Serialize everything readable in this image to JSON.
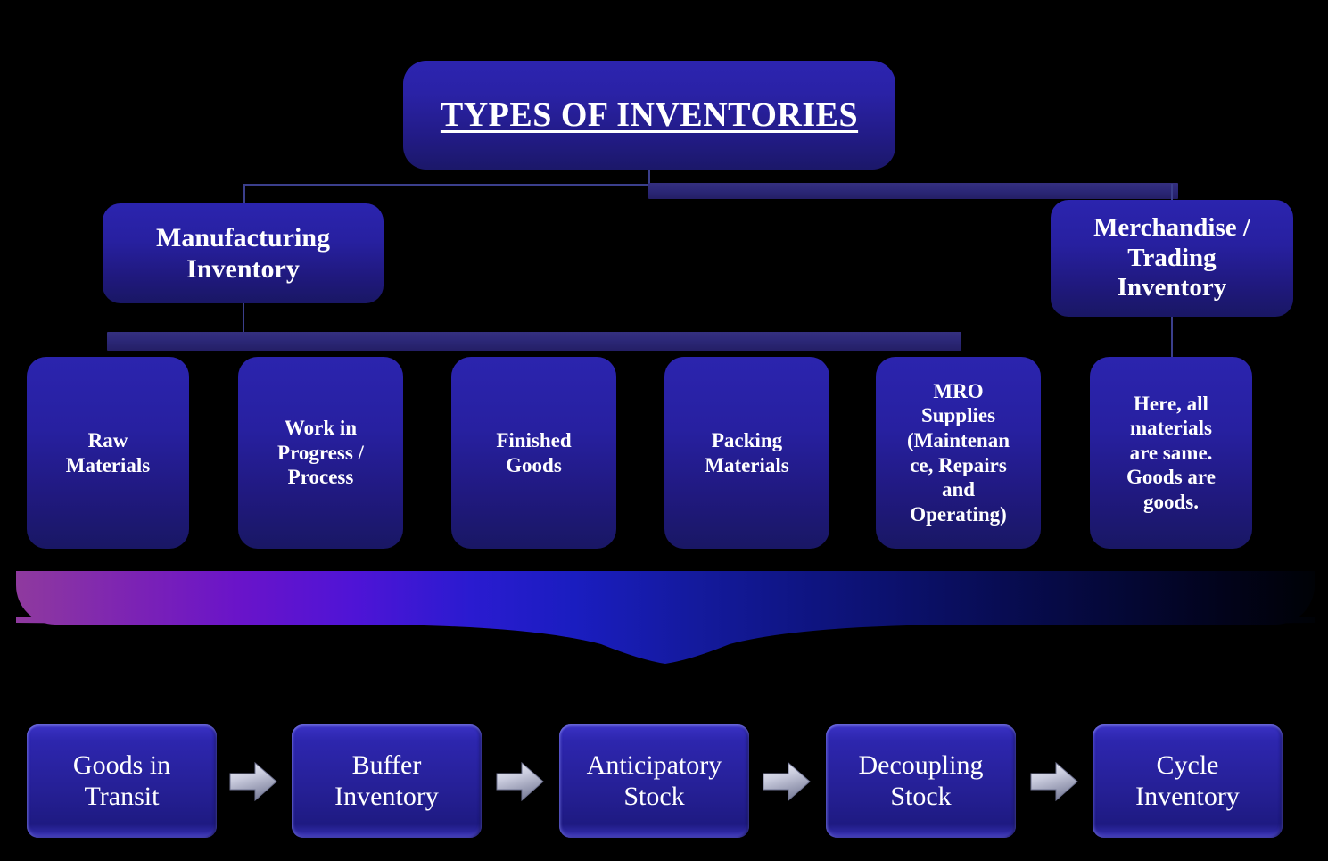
{
  "title": {
    "label": "TYPES OF INVENTORIES"
  },
  "level2": [
    {
      "name": "manufacturing-inventory",
      "label": "Manufacturing\nInventory"
    },
    {
      "name": "merchandise-trading-inventory",
      "label": "Merchandise /\nTrading\nInventory"
    }
  ],
  "level3": [
    {
      "name": "raw-materials",
      "label": "Raw\nMaterials"
    },
    {
      "name": "work-in-progress",
      "label": "Work in\nProgress /\nProcess"
    },
    {
      "name": "finished-goods",
      "label": "Finished\nGoods"
    },
    {
      "name": "packing-materials",
      "label": "Packing\nMaterials"
    },
    {
      "name": "mro-supplies",
      "label": "MRO\nSupplies\n(Maintenan\nce, Repairs\nand\nOperating)"
    },
    {
      "name": "merchandise-note",
      "label": "Here, all\nmaterials\nare same.\nGoods are\ngoods."
    }
  ],
  "process_flow": [
    {
      "name": "goods-in-transit",
      "label": "Goods in\nTransit"
    },
    {
      "name": "buffer-inventory",
      "label": "Buffer\nInventory"
    },
    {
      "name": "anticipatory-stock",
      "label": "Anticipatory\nStock"
    },
    {
      "name": "decoupling-stock",
      "label": "Decoupling\nStock"
    },
    {
      "name": "cycle-inventory",
      "label": "Cycle\nInventory"
    }
  ],
  "icons": {
    "flow_arrow": "right-arrow-icon"
  },
  "colors": {
    "background": "#000000",
    "box_fill_top": "#2b24ae",
    "box_fill_bottom": "#191764",
    "chip_fill": "#2d26ae",
    "text": "#ffffff",
    "connector": "#3b3f8c",
    "bar": "#2c2878",
    "swoosh_start": "#8f3a9e",
    "swoosh_mid": "#1a1dc0",
    "swoosh_end": "#000206",
    "arrow_light": "#e8e9f4",
    "arrow_dark": "#7d82a0"
  }
}
